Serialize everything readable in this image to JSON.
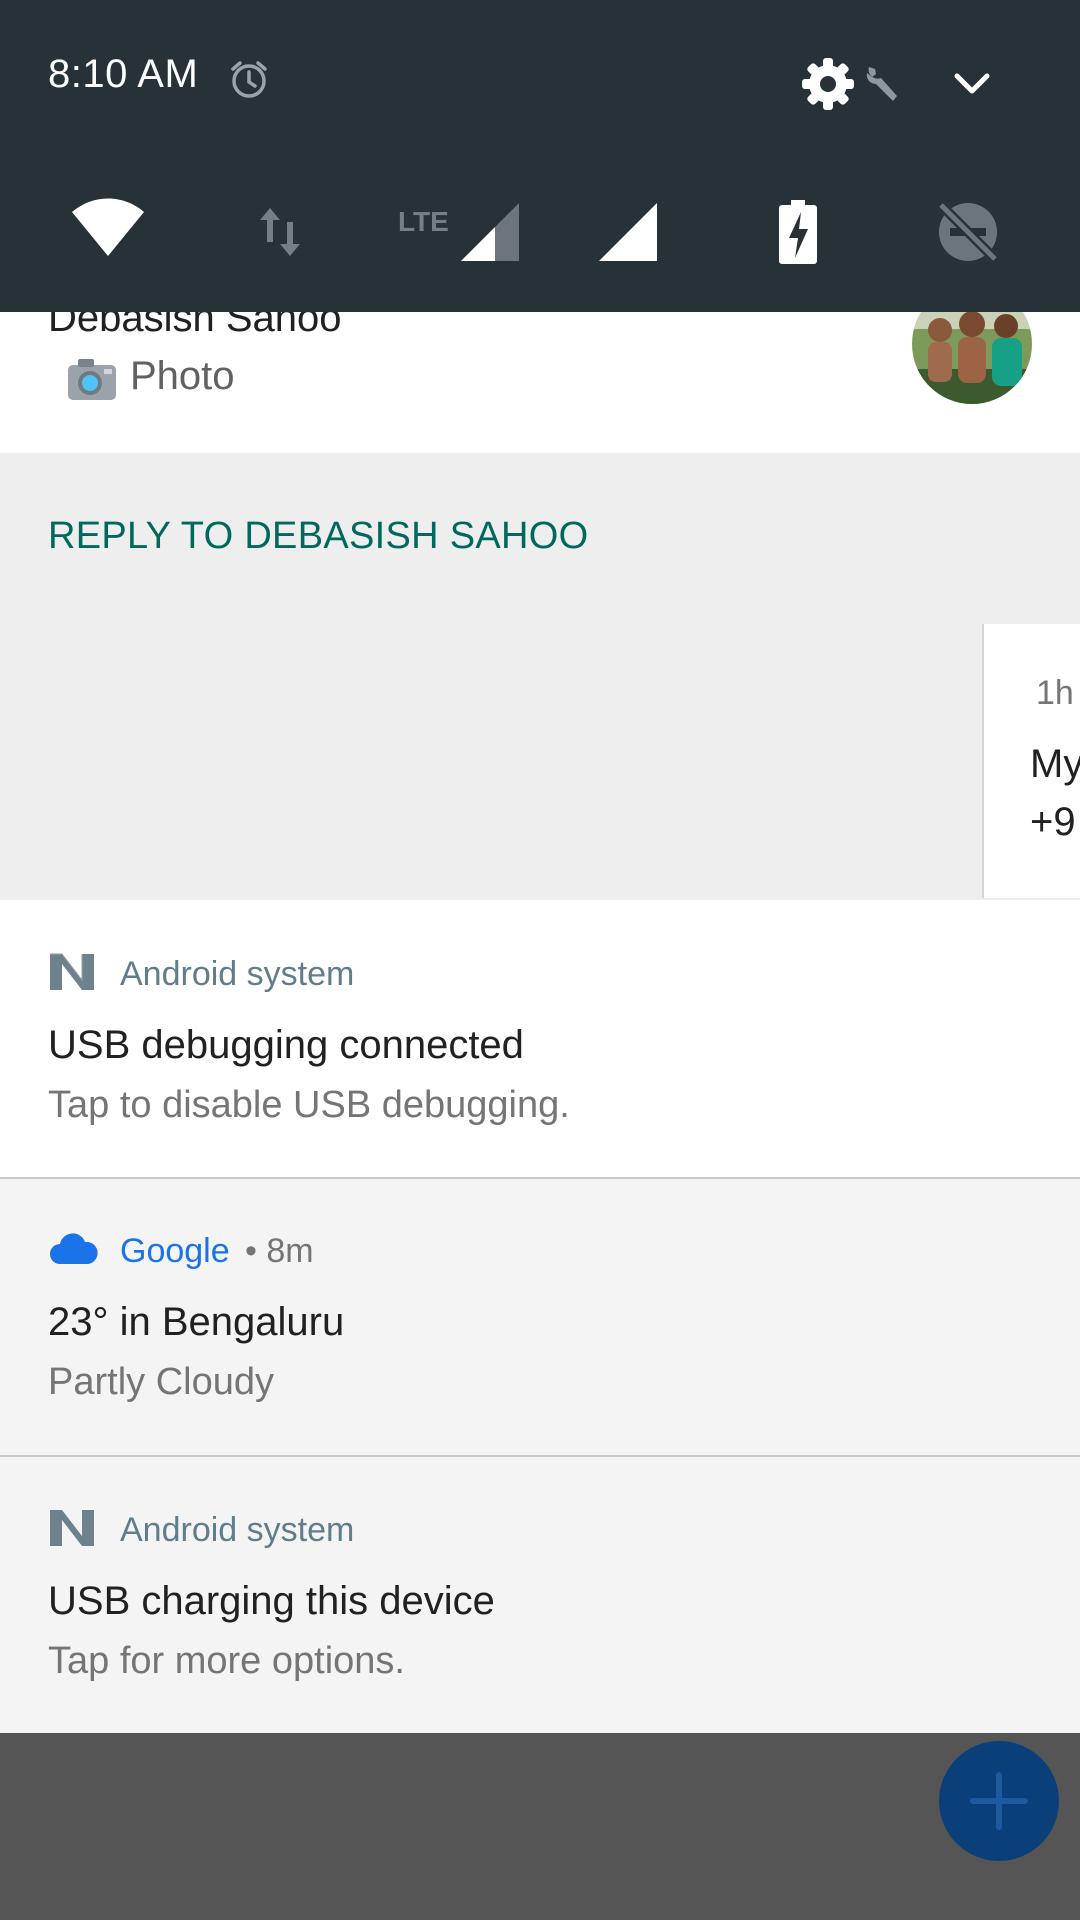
{
  "status": {
    "time": "8:10 AM",
    "network_type": "LTE"
  },
  "icons": {
    "alarm": "alarm-clock-icon",
    "settings": "gear-icon",
    "wrench": "wrench-icon",
    "expand": "chevron-down-icon",
    "wifi": "wifi-icon",
    "data": "data-transfer-icon",
    "signal": "cell-signal-icon",
    "battery": "battery-charging-icon",
    "dnd": "do-not-disturb-off-icon"
  },
  "message_notification": {
    "sender": "Debasish Sahoo",
    "snippet": "Photo",
    "reply_action": "REPLY TO DEBASISH SAHOO"
  },
  "swiped_notification": {
    "time": "1h",
    "title": "My",
    "text": "+9"
  },
  "notifications": [
    {
      "app": "Android system",
      "meta": "",
      "title": "USB debugging connected",
      "text": "Tap to disable USB debugging."
    },
    {
      "app": "Google",
      "meta": "• 8m",
      "title": "23° in Bengaluru",
      "text": "Partly Cloudy"
    },
    {
      "app": "Android system",
      "meta": "",
      "title": "USB charging this device",
      "text": "Tap for more options."
    }
  ],
  "colors": {
    "header_bg": "#263238",
    "accent_reply": "#00695c",
    "google_blue": "#1a73e8",
    "fab": "#0b3f7a"
  }
}
